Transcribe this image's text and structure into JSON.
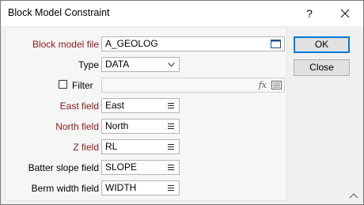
{
  "dialog": {
    "title": "Block Model Constraint",
    "help": "?"
  },
  "fields": {
    "block_model_file": {
      "label": "Block model file",
      "value": "A_GEOLOG"
    },
    "type": {
      "label": "Type",
      "value": "DATA"
    },
    "filter": {
      "label": "Filter",
      "value": "",
      "checked": false,
      "expr_icon": "fx"
    },
    "east": {
      "label": "East field",
      "value": "East"
    },
    "north": {
      "label": "North field",
      "value": "North"
    },
    "z": {
      "label": "Z field",
      "value": "RL"
    },
    "batter": {
      "label": "Batter slope field",
      "value": "SLOPE"
    },
    "berm": {
      "label": "Berm width field",
      "value": "WIDTH"
    }
  },
  "buttons": {
    "ok": "OK",
    "close": "Close"
  },
  "colors": {
    "required_label": "#8b1a1a",
    "default_button_border": "#0078d7"
  }
}
